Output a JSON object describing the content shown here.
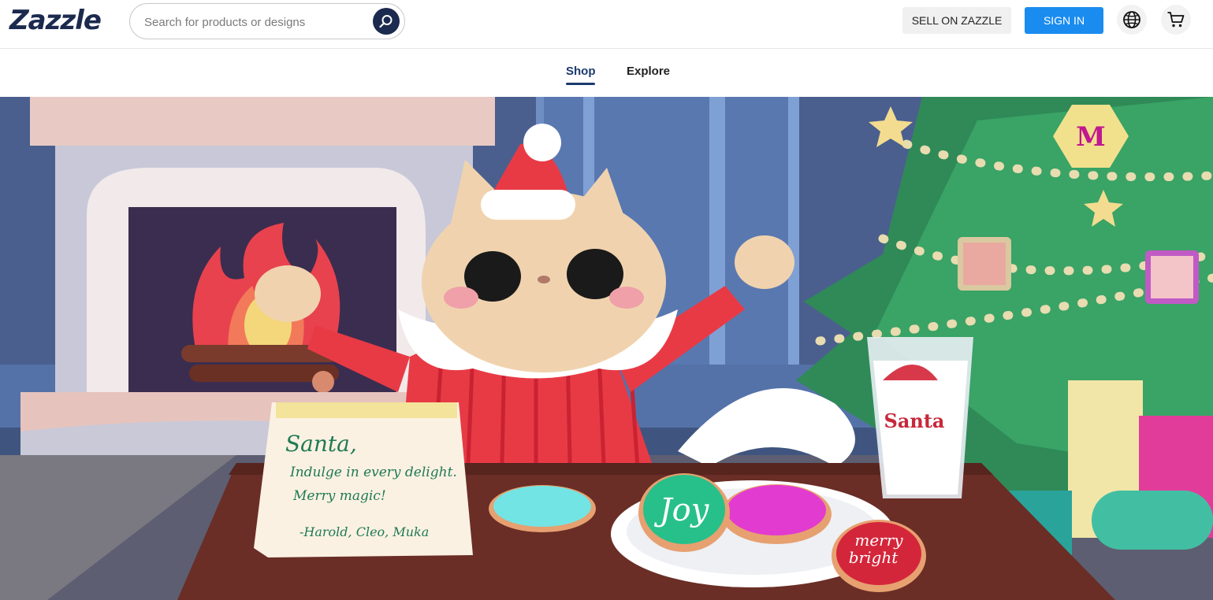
{
  "header": {
    "logo": "Zazzle",
    "search_placeholder": "Search for products or designs",
    "sell_label": "SELL ON ZAZZLE",
    "signin_label": "SIGN IN"
  },
  "nav": {
    "tabs": [
      {
        "label": "Shop",
        "active": true
      },
      {
        "label": "Explore",
        "active": false
      }
    ]
  },
  "hero": {
    "note_lines": [
      "Santa,",
      "Indulge in every delight.",
      "Merry magic!",
      "-Harold, Cleo, Muka"
    ],
    "cookie_joy": "Joy",
    "cookie_merry": "merry",
    "cookie_bright": "bright",
    "glass_label": "Santa",
    "ornament_letter": "M"
  },
  "colors": {
    "brand_navy": "#1b2a4e",
    "signin_blue": "#1a8cf0",
    "active_tab": "#1b3a6e"
  }
}
